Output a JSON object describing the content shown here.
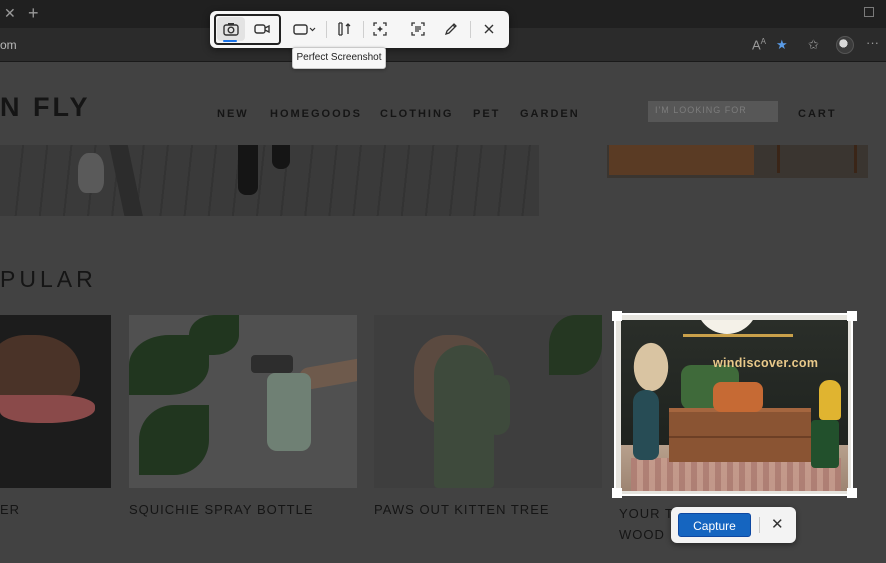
{
  "browser": {
    "url_fragment": "om",
    "icons": [
      "tab-close-icon",
      "new-tab-icon",
      "read-aloud-icon",
      "favorite-star-icon",
      "favorites-icon",
      "profile-avatar",
      "more-icon"
    ]
  },
  "site": {
    "logo": "N FLY",
    "nav": [
      "NEW",
      "HOMEGOODS",
      "CLOTHING",
      "PET",
      "GARDEN"
    ],
    "search_placeholder": "I'M LOOKING FOR",
    "cart": "CART",
    "section_title": "PULAR",
    "products": [
      {
        "label": "ER"
      },
      {
        "label": "SQUICHIE SPRAY BOTTLE"
      },
      {
        "label": "PAWS OUT KITTEN TREE"
      },
      {
        "label": "YOUR T WOOD"
      }
    ]
  },
  "selection": {
    "watermark": "windiscover.com"
  },
  "capture_bar": {
    "capture_label": "Capture",
    "close_icon": "close-icon"
  },
  "snipping_toolbar": {
    "tooltip": "Perfect Screenshot",
    "accent": "#1a73e8",
    "tools": [
      "camera-icon",
      "video-icon",
      "rectangle-mode-icon",
      "perfect-screenshot-icon",
      "ai-select-icon",
      "text-scan-icon",
      "pen-icon",
      "close-icon"
    ]
  },
  "colors": {
    "capture_button": "#1565c0",
    "dim_overlay": "#424242"
  }
}
